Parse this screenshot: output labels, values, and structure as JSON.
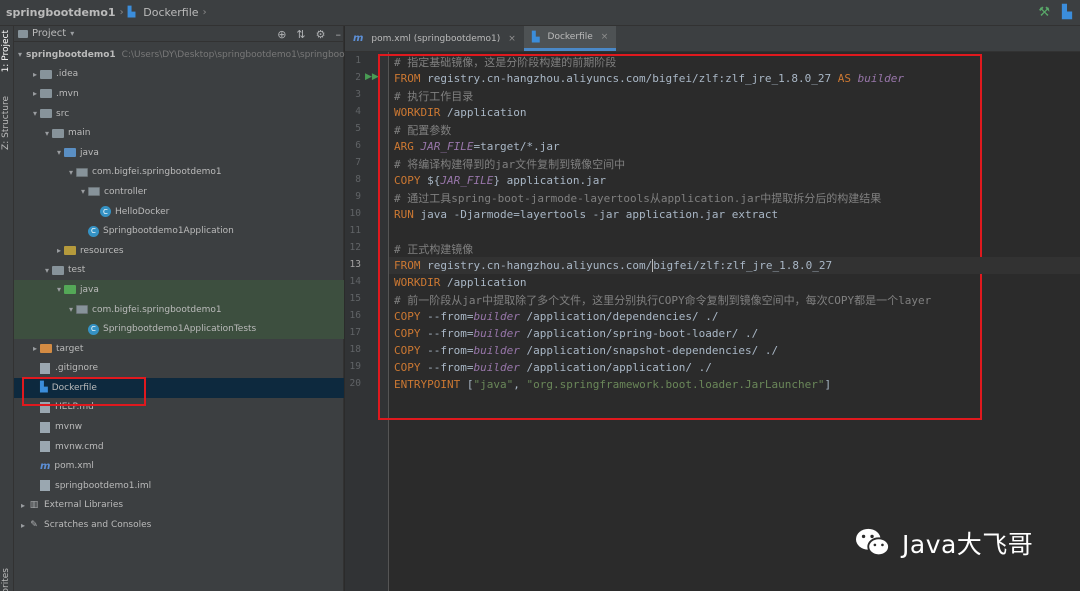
{
  "breadcrumb": {
    "project": "springbootdemo1",
    "file": "Dockerfile"
  },
  "side_tabs": {
    "project": "1: Project",
    "structure": "Z: Structure",
    "favorites": "orites"
  },
  "project_panel": {
    "title": "Project",
    "tree": [
      {
        "label": "springbootdemo1",
        "extra": "C:\\Users\\DY\\Desktop\\springbootdemo1\\springbootd",
        "indent": 0,
        "arrow": "▾",
        "icon": "folder"
      },
      {
        "label": ".idea",
        "indent": 1,
        "arrow": "▸",
        "icon": "folder"
      },
      {
        "label": ".mvn",
        "indent": 1,
        "arrow": "▸",
        "icon": "folder"
      },
      {
        "label": "src",
        "indent": 1,
        "arrow": "▾",
        "icon": "folder"
      },
      {
        "label": "main",
        "indent": 2,
        "arrow": "▾",
        "icon": "folder"
      },
      {
        "label": "java",
        "indent": 3,
        "arrow": "▾",
        "icon": "folder-src"
      },
      {
        "label": "com.bigfei.springbootdemo1",
        "indent": 4,
        "arrow": "▾",
        "icon": "package"
      },
      {
        "label": "controller",
        "indent": 5,
        "arrow": "▾",
        "icon": "package"
      },
      {
        "label": "HelloDocker",
        "indent": 6,
        "arrow": "",
        "icon": "class"
      },
      {
        "label": "Springbootdemo1Application",
        "indent": 5,
        "arrow": "",
        "icon": "class"
      },
      {
        "label": "resources",
        "indent": 3,
        "arrow": "▸",
        "icon": "folder-res"
      },
      {
        "label": "test",
        "indent": 2,
        "arrow": "▾",
        "icon": "folder"
      },
      {
        "label": "java",
        "indent": 3,
        "arrow": "▾",
        "icon": "folder-test",
        "highlight": true
      },
      {
        "label": "com.bigfei.springbootdemo1",
        "indent": 4,
        "arrow": "▾",
        "icon": "package",
        "highlight": true
      },
      {
        "label": "Springbootdemo1ApplicationTests",
        "indent": 5,
        "arrow": "",
        "icon": "class",
        "highlight": true
      },
      {
        "label": "target",
        "indent": 1,
        "arrow": "▸",
        "icon": "folder-target"
      },
      {
        "label": ".gitignore",
        "indent": 1,
        "arrow": "",
        "icon": "file"
      },
      {
        "label": "Dockerfile",
        "indent": 1,
        "arrow": "",
        "icon": "docker",
        "selected": true
      },
      {
        "label": "HELP.md",
        "indent": 1,
        "arrow": "",
        "icon": "file"
      },
      {
        "label": "mvnw",
        "indent": 1,
        "arrow": "",
        "icon": "file"
      },
      {
        "label": "mvnw.cmd",
        "indent": 1,
        "arrow": "",
        "icon": "file"
      },
      {
        "label": "pom.xml",
        "indent": 1,
        "arrow": "",
        "icon": "maven"
      },
      {
        "label": "springbootdemo1.iml",
        "indent": 1,
        "arrow": "",
        "icon": "file"
      },
      {
        "label": "External Libraries",
        "indent": 0,
        "arrow": "▸",
        "icon": "library"
      },
      {
        "label": "Scratches and Consoles",
        "indent": 0,
        "arrow": "▸",
        "icon": "scratch"
      }
    ]
  },
  "editor_tabs": [
    {
      "label": "pom.xml (springbootdemo1)",
      "icon": "maven",
      "active": false
    },
    {
      "label": "Dockerfile",
      "icon": "docker",
      "active": true
    }
  ],
  "code": [
    {
      "n": "1",
      "parts": [
        [
          "c",
          "# 指定基础镜像，这是分阶段构建的前期阶段"
        ]
      ]
    },
    {
      "n": "2",
      "run": true,
      "parts": [
        [
          "k",
          "FROM "
        ],
        [
          "p",
          "registry.cn-hangzhou.aliyuncs.com/bigfei/zlf:zlf_jre_1.8.0_27 "
        ],
        [
          "k",
          "AS "
        ],
        [
          "it",
          "builder"
        ]
      ]
    },
    {
      "n": "3",
      "parts": [
        [
          "c",
          "# 执行工作目录"
        ]
      ]
    },
    {
      "n": "4",
      "parts": [
        [
          "k",
          "WORKDIR "
        ],
        [
          "p",
          "/application"
        ]
      ]
    },
    {
      "n": "5",
      "parts": [
        [
          "c",
          "# 配置参数"
        ]
      ]
    },
    {
      "n": "6",
      "parts": [
        [
          "k",
          "ARG "
        ],
        [
          "it",
          "JAR_FILE"
        ],
        [
          "p",
          "=target/*.jar"
        ]
      ]
    },
    {
      "n": "7",
      "parts": [
        [
          "c",
          "# 将编译构建得到的jar文件复制到镜像空间中"
        ]
      ]
    },
    {
      "n": "8",
      "parts": [
        [
          "k",
          "COPY "
        ],
        [
          "p",
          "${"
        ],
        [
          "it",
          "JAR_FILE"
        ],
        [
          "p",
          "} application.jar"
        ]
      ]
    },
    {
      "n": "9",
      "parts": [
        [
          "c",
          "# 通过工具spring-boot-jarmode-layertools从application.jar中提取拆分后的构建结果"
        ]
      ]
    },
    {
      "n": "10",
      "parts": [
        [
          "k",
          "RUN "
        ],
        [
          "p",
          "java -Djarmode=layertools -jar application.jar extract"
        ]
      ]
    },
    {
      "n": "11",
      "parts": []
    },
    {
      "n": "12",
      "parts": [
        [
          "c",
          "# 正式构建镜像"
        ]
      ]
    },
    {
      "n": "13",
      "current": true,
      "parts": [
        [
          "k",
          "FROM "
        ],
        [
          "p",
          "registry.cn-hangzhou.aliyuncs.com/"
        ],
        [
          "caret",
          ""
        ],
        [
          "p",
          "bigfei/zlf:zlf_jre_1.8.0_27"
        ]
      ]
    },
    {
      "n": "14",
      "parts": [
        [
          "k",
          "WORKDIR "
        ],
        [
          "p",
          "/application"
        ]
      ]
    },
    {
      "n": "15",
      "parts": [
        [
          "c",
          "# 前一阶段从jar中提取除了多个文件，这里分别执行COPY命令复制到镜像空间中，每次COPY都是一个layer"
        ]
      ]
    },
    {
      "n": "16",
      "parts": [
        [
          "k",
          "COPY "
        ],
        [
          "p",
          "--from="
        ],
        [
          "it",
          "builder"
        ],
        [
          "p",
          " /application/dependencies/ ./"
        ]
      ]
    },
    {
      "n": "17",
      "parts": [
        [
          "k",
          "COPY "
        ],
        [
          "p",
          "--from="
        ],
        [
          "it",
          "builder"
        ],
        [
          "p",
          " /application/spring-boot-loader/ ./"
        ]
      ]
    },
    {
      "n": "18",
      "parts": [
        [
          "k",
          "COPY "
        ],
        [
          "p",
          "--from="
        ],
        [
          "it",
          "builder"
        ],
        [
          "p",
          " /application/snapshot-dependencies/ ./"
        ]
      ]
    },
    {
      "n": "19",
      "parts": [
        [
          "k",
          "COPY "
        ],
        [
          "p",
          "--from="
        ],
        [
          "it",
          "builder"
        ],
        [
          "p",
          " /application/application/ ./"
        ]
      ]
    },
    {
      "n": "20",
      "parts": [
        [
          "k",
          "ENTRYPOINT "
        ],
        [
          "p",
          "["
        ],
        [
          "s",
          "\"java\""
        ],
        [
          "p",
          ", "
        ],
        [
          "s",
          "\"org.springframework.boot.loader.JarLauncher\""
        ],
        [
          "p",
          "]"
        ]
      ]
    }
  ],
  "watermark": {
    "text": "Java大飞哥",
    "icon": "wechat-icon"
  },
  "colors": {
    "accent": "#4a88c7",
    "annotation": "#e0191e",
    "keyword": "#cc7832",
    "comment": "#808080",
    "string": "#6a8759"
  }
}
